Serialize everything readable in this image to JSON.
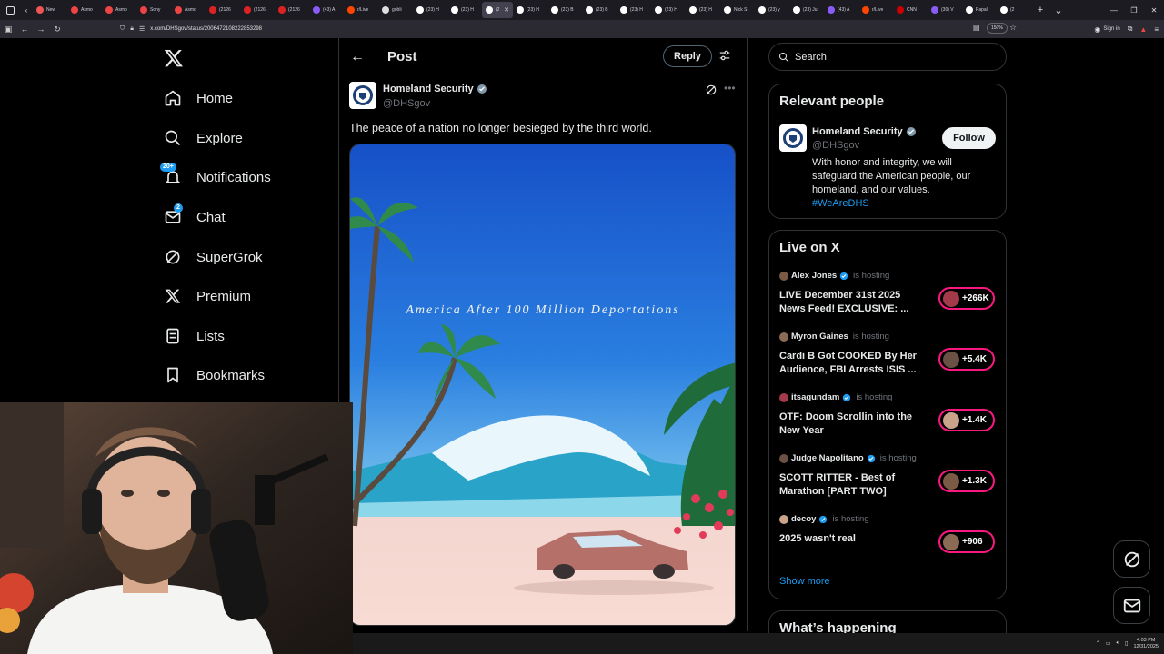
{
  "browser": {
    "tabs": [
      {
        "label": "New",
        "color": "#e55"
      },
      {
        "label": "Asmo",
        "color": "#e44"
      },
      {
        "label": "Asmo",
        "color": "#e44"
      },
      {
        "label": "Sony",
        "color": "#e44"
      },
      {
        "label": "Asmo",
        "color": "#e44"
      },
      {
        "label": "(2126",
        "color": "#d22"
      },
      {
        "label": "(2126",
        "color": "#d22"
      },
      {
        "label": "(2126",
        "color": "#d22"
      },
      {
        "label": "(43) A",
        "color": "#8a5cf6"
      },
      {
        "label": "r/Live",
        "color": "#ff4500"
      },
      {
        "label": "gobli",
        "color": "#ddd"
      },
      {
        "label": "(23) H",
        "color": "#fff"
      },
      {
        "label": "(23) H",
        "color": "#fff"
      },
      {
        "label": "(2",
        "color": "#fff",
        "active": true
      },
      {
        "label": "(23) H",
        "color": "#fff"
      },
      {
        "label": "(23) B",
        "color": "#fff"
      },
      {
        "label": "(23) B",
        "color": "#fff"
      },
      {
        "label": "(23) H",
        "color": "#fff"
      },
      {
        "label": "(23) H",
        "color": "#fff"
      },
      {
        "label": "(23) H",
        "color": "#fff"
      },
      {
        "label": "Nick S",
        "color": "#fff"
      },
      {
        "label": "(23) y",
        "color": "#fff"
      },
      {
        "label": "(23) Ju",
        "color": "#fff"
      },
      {
        "label": "(43) A",
        "color": "#8a5cf6"
      },
      {
        "label": "r/Live",
        "color": "#ff4500"
      },
      {
        "label": "CNN",
        "color": "#c00"
      },
      {
        "label": "(30) V",
        "color": "#8a5cf6"
      },
      {
        "label": "Papal",
        "color": "#fff"
      },
      {
        "label": "(2",
        "color": "#fff"
      }
    ],
    "url": "x.com/DHSgov/status/2006472108222853298",
    "zoom": "150%",
    "signin": "Sign in"
  },
  "nav": {
    "items": [
      {
        "label": "Home",
        "icon": "home-icon"
      },
      {
        "label": "Explore",
        "icon": "search-icon"
      },
      {
        "label": "Notifications",
        "icon": "bell-icon",
        "badge": "20+"
      },
      {
        "label": "Chat",
        "icon": "mail-icon",
        "badge": "2"
      },
      {
        "label": "SuperGrok",
        "icon": "grok-icon"
      },
      {
        "label": "Premium",
        "icon": "x-icon"
      },
      {
        "label": "Lists",
        "icon": "list-icon"
      },
      {
        "label": "Bookmarks",
        "icon": "bookmark-icon"
      }
    ]
  },
  "post": {
    "header_title": "Post",
    "reply_label": "Reply",
    "author_name": "Homeland Security",
    "author_handle": "@DHSgov",
    "text": "The peace of a nation no longer besieged by the third world.",
    "image_caption": "America After 100 Million Deportations"
  },
  "sidebar": {
    "search_placeholder": "Search",
    "relevant": {
      "title": "Relevant people",
      "name": "Homeland Security",
      "handle": "@DHSgov",
      "follow_label": "Follow",
      "bio": "With honor and integrity, we will safeguard the American people, our homeland, and our values.",
      "hashtag": "#WeAreDHS"
    },
    "live": {
      "title": "Live on X",
      "hosting_label": "is hosting",
      "items": [
        {
          "host": "Alex Jones",
          "verified": true,
          "title": "LIVE December 31st 2025 News Feed! EXCLUSIVE: ...",
          "count": "+266K"
        },
        {
          "host": "Myron Gaines",
          "verified": false,
          "title": "Cardi B Got COOKED By Her Audience, FBI Arrests ISIS ...",
          "count": "+5.4K"
        },
        {
          "host": "itsagundam",
          "verified": true,
          "title": "OTF: Doom Scrollin into the New Year",
          "count": "+1.4K"
        },
        {
          "host": "Judge Napolitano",
          "verified": true,
          "title": "SCOTT RITTER -  Best of Marathon  [PART TWO]",
          "count": "+1.3K"
        },
        {
          "host": "decoy",
          "verified": true,
          "title": "2025 wasn't real",
          "count": "+906"
        }
      ],
      "show_more": "Show more"
    },
    "whats_happening": "What’s happening"
  },
  "taskbar": {
    "time": "4:03 PM",
    "date": "12/31/2025"
  },
  "colors": {
    "accent": "#1d9bf0",
    "live": "#f91880",
    "border": "#2f3336",
    "muted": "#71767b"
  }
}
